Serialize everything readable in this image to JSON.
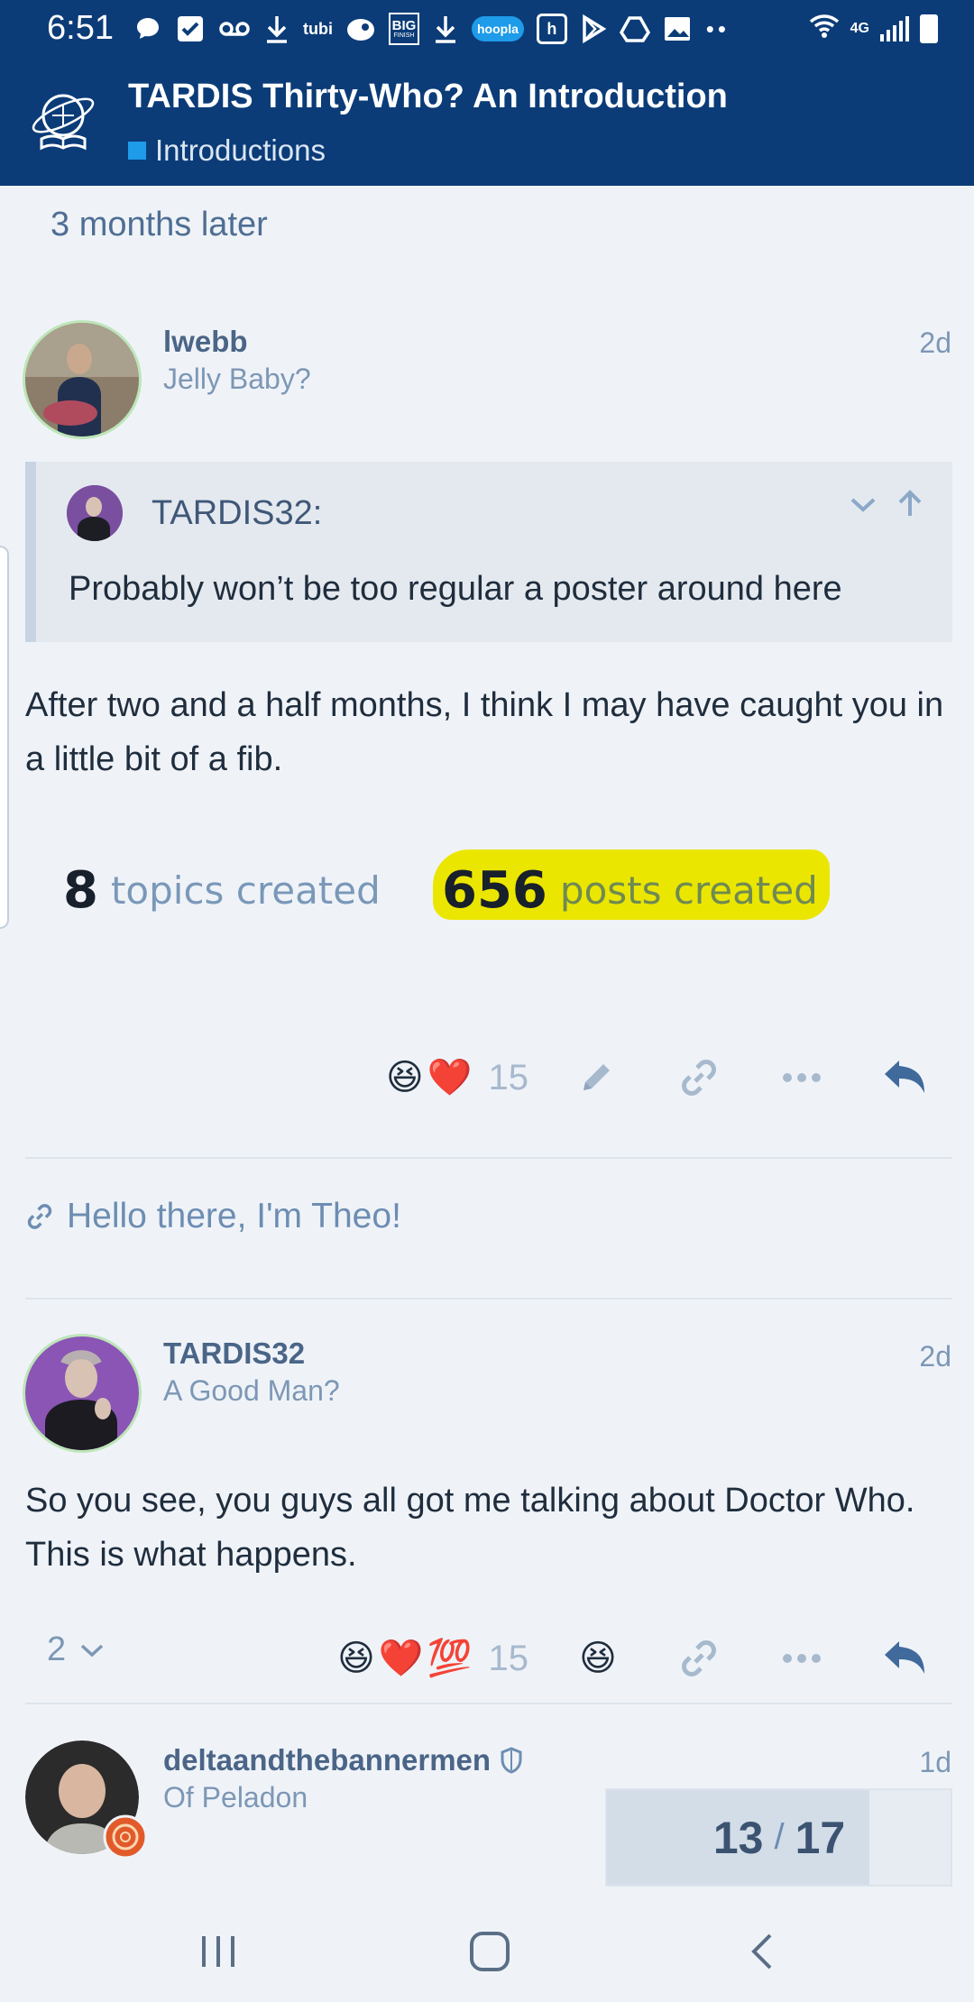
{
  "status_bar": {
    "time": "6:51",
    "icons": [
      "message-icon",
      "call-filter-icon",
      "voicemail-icon",
      "download-icon",
      "tubi-icon",
      "pluto-icon",
      "big-finish-icon",
      "download-icon",
      "hoopla-icon",
      "h-icon",
      "play-store-icon",
      "drive-icon",
      "gallery-icon",
      "more-dots-icon"
    ],
    "icon_labels": {
      "tubi": "tubi",
      "big1": "BIG",
      "big2": "FINISH",
      "hoopla": "hoopla",
      "h": "h"
    },
    "network": "4G",
    "battery": "full"
  },
  "header": {
    "title": "TARDIS Thirty-Who? An Introduction",
    "category": "Introductions",
    "category_color": "#1e9be9",
    "bar_color": "#0b3c78"
  },
  "time_gap": "3 months later",
  "post1": {
    "username": "lwebb",
    "user_title": "Jelly Baby?",
    "date": "2d",
    "quote": {
      "username": "TARDIS32:",
      "text": "Probably won’t be too regular a poster around here"
    },
    "body": "After two and a half months, I think I may have caught you in a little bit of a fib.",
    "stats_image": {
      "topics_num": "8",
      "topics_label": "topics created",
      "posts_num": "656",
      "posts_label": "posts created",
      "highlight_color": "#ebe600"
    },
    "reactions": [
      "😆",
      "❤️"
    ],
    "reaction_count": "15"
  },
  "linked_topic": "Hello there, I'm Theo!",
  "post2": {
    "username": "TARDIS32",
    "user_title": "A Good Man?",
    "date": "2d",
    "body": "So you see, you guys all got me talking about Doctor Who. This is what happens.",
    "replies_count": "2",
    "reactions": [
      "😆",
      "❤️",
      "💯"
    ],
    "reaction_count": "15",
    "my_reaction": "😆"
  },
  "post3": {
    "username": "deltaandthebannermen",
    "user_title": "Of Peladon",
    "date": "1d"
  },
  "progress": {
    "current": "13",
    "separator": "/",
    "total": "17",
    "fraction": 0.7647
  },
  "nav": {
    "icons": [
      "recent-apps-icon",
      "home-icon",
      "back-icon"
    ]
  }
}
